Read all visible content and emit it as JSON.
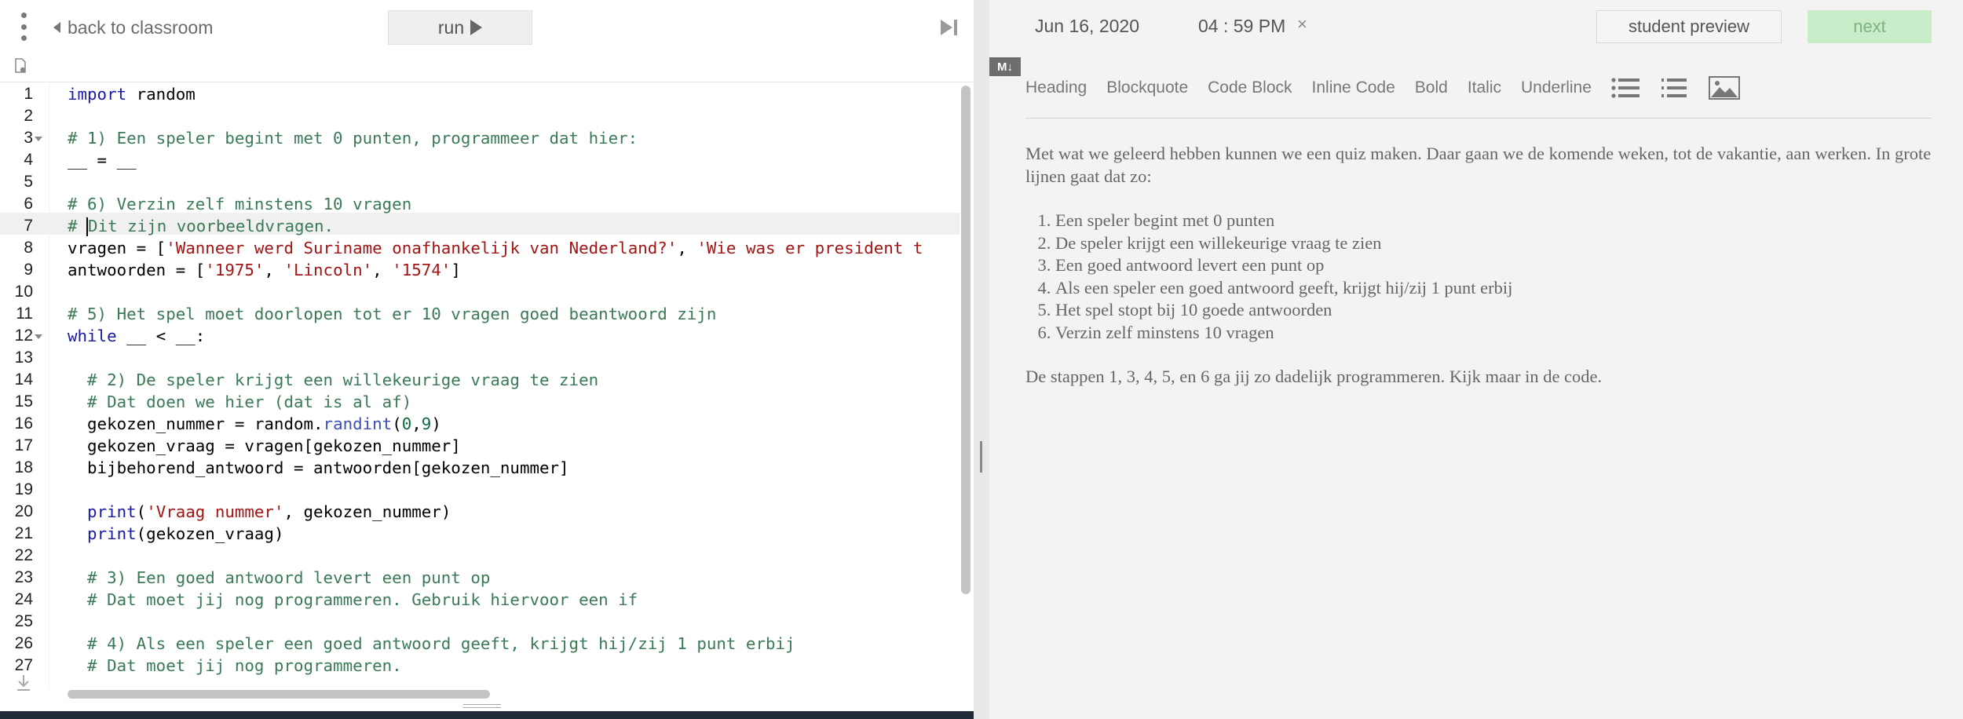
{
  "editor": {
    "back_label": "back to classroom",
    "run_label": "run",
    "line_numbers": [
      "1",
      "2",
      "3",
      "4",
      "5",
      "6",
      "7",
      "8",
      "9",
      "10",
      "11",
      "12",
      "13",
      "14",
      "15",
      "16",
      "17",
      "18",
      "19",
      "20",
      "21",
      "22",
      "23",
      "24",
      "25",
      "26",
      "27"
    ],
    "code": {
      "l1_kw": "import",
      "l1_rest": " random",
      "l3": "# 1) Een speler begint met 0 punten, programmeer dat hier:",
      "l4": "__ = __",
      "l6": "# 6) Verzin zelf minstens 10 vragen",
      "l7a": "# ",
      "l7b": "Dit zijn voorbeeldvragen.",
      "l8_a": "vragen = [",
      "l8_s1": "'Wanneer werd Suriname onafhankelijk van Nederland?'",
      "l8_b": ", ",
      "l8_s2": "'Wie was er president t",
      "l9_a": "antwoorden = [",
      "l9_s1": "'1975'",
      "l9_b": ", ",
      "l9_s2": "'Lincoln'",
      "l9_c": ", ",
      "l9_s3": "'1574'",
      "l9_d": "]",
      "l11": "# 5) Het spel moet doorlopen tot er 10 vragen goed beantwoord zijn",
      "l12_kw": "while",
      "l12_rest": " __ < __:",
      "l14": "  # 2) De speler krijgt een willekeurige vraag te zien",
      "l15": "  # Dat doen we hier (dat is al af)",
      "l16_a": "  gekozen_nummer = random.",
      "l16_fn": "randint",
      "l16_b": "(",
      "l16_n1": "0",
      "l16_c": ",",
      "l16_n2": "9",
      "l16_d": ")",
      "l17": "  gekozen_vraag = vragen[gekozen_nummer]",
      "l18": "  bijbehorend_antwoord = antwoorden[gekozen_nummer]",
      "l20_kw": "print",
      "l20_a": "(",
      "l20_s": "'Vraag nummer'",
      "l20_b": ", gekozen_nummer)",
      "l21_kw": "print",
      "l21_a": "(gekozen_vraag)",
      "l23": "  # 3) Een goed antwoord levert een punt op",
      "l24": "  # Dat moet jij nog programmeren. Gebruik hiervoor een if",
      "l26": "  # 4) Als een speler een goed antwoord geeft, krijgt hij/zij 1 punt erbij",
      "l27": "  # Dat moet jij nog programmeren."
    }
  },
  "header": {
    "date": "Jun 16, 2020",
    "time": "04 : 59 PM",
    "close_glyph": "×",
    "preview_label": "student preview",
    "next_label": "next"
  },
  "markdown": {
    "logo": "M↓",
    "toolbar": [
      "Heading",
      "Blockquote",
      "Code Block",
      "Inline Code",
      "Bold",
      "Italic",
      "Underline"
    ],
    "toolbar_icons": [
      "bulleted-list-icon",
      "numbered-list-icon",
      "image-icon"
    ],
    "intro": "Met wat we geleerd hebben kunnen we een quiz maken. Daar gaan we de komende weken, tot de vakantie, aan werken. In grote lijnen gaat dat zo:",
    "steps": [
      "Een speler begint met 0 punten",
      "De speler krijgt een willekeurige vraag te zien",
      "Een goed antwoord levert een punt op",
      "Als een speler een goed antwoord geeft, krijgt hij/zij 1 punt erbij",
      "Het spel stopt bij 10 goede antwoorden",
      "Verzin zelf minstens 10 vragen"
    ],
    "outro": "De stappen 1, 3, 4, 5, en 6 ga jij zo dadelijk programmeren. Kijk maar in de code."
  },
  "colors": {
    "comment": "#3b7a57",
    "keyword": "#1a1aa6",
    "string": "#a31515",
    "number": "#0b6b3a",
    "next_button_bg": "#c9ecc9"
  }
}
